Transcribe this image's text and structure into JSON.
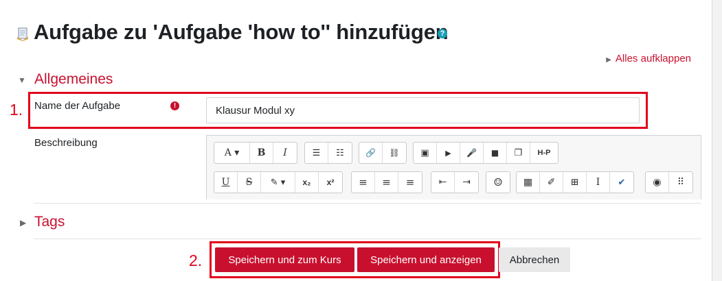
{
  "header": {
    "title": "Aufgabe zu 'Aufgabe 'how to'' hinzufügen",
    "help_icon": "question-circle-icon",
    "help_glyph": "?"
  },
  "expand_all": "Alles aufklappen",
  "sections": {
    "general": {
      "title": "Allgemeines"
    },
    "tags": {
      "title": "Tags"
    }
  },
  "fields": {
    "name": {
      "label": "Name der Aufgabe",
      "value": "Klausur Modul xy",
      "required_glyph": "!"
    },
    "description": {
      "label": "Beschreibung"
    }
  },
  "toolbar": {
    "row1": [
      {
        "name": "font-style-button",
        "glyph": "A ▾"
      },
      {
        "name": "bold-button",
        "glyph": "B"
      },
      {
        "name": "italic-button",
        "glyph": "I"
      },
      {
        "name": "unordered-list-button",
        "glyph": "☰"
      },
      {
        "name": "ordered-list-button",
        "glyph": "☷"
      },
      {
        "name": "link-button",
        "glyph": "🔗"
      },
      {
        "name": "unlink-button",
        "glyph": "⛓"
      },
      {
        "name": "image-button",
        "glyph": "▣"
      },
      {
        "name": "media-button",
        "glyph": "▶"
      },
      {
        "name": "record-audio-button",
        "glyph": "🎤"
      },
      {
        "name": "record-video-button",
        "glyph": "■"
      },
      {
        "name": "manage-files-button",
        "glyph": "❐"
      },
      {
        "name": "h5p-button",
        "glyph": "H-P"
      }
    ],
    "row2": [
      {
        "name": "underline-button",
        "glyph": "U"
      },
      {
        "name": "strikethrough-button",
        "glyph": "S"
      },
      {
        "name": "text-color-button",
        "glyph": "✎ ▾"
      },
      {
        "name": "subscript-button",
        "glyph": "x₂"
      },
      {
        "name": "superscript-button",
        "glyph": "x²"
      },
      {
        "name": "align-left-button",
        "glyph": "≡"
      },
      {
        "name": "align-center-button",
        "glyph": "≡"
      },
      {
        "name": "align-right-button",
        "glyph": "≡"
      },
      {
        "name": "outdent-button",
        "glyph": "⇤"
      },
      {
        "name": "indent-button",
        "glyph": "⇥"
      },
      {
        "name": "emoticon-button",
        "glyph": "☺"
      },
      {
        "name": "equation-button",
        "glyph": "▦"
      },
      {
        "name": "edit-button",
        "glyph": "✐"
      },
      {
        "name": "table-button",
        "glyph": "⊞"
      },
      {
        "name": "cursor-button",
        "glyph": "I"
      },
      {
        "name": "checkmark-button",
        "glyph": "✔"
      },
      {
        "name": "accessibility-button",
        "glyph": "◉"
      },
      {
        "name": "braille-button",
        "glyph": "⠿"
      }
    ]
  },
  "annotations": {
    "first": "1.",
    "second": "2."
  },
  "buttons": {
    "save_return": "Speichern und zum Kurs",
    "save_display": "Speichern und anzeigen",
    "cancel": "Abbrechen"
  },
  "colors": {
    "accent": "#c8102e",
    "annotation": "#e1001a",
    "help": "#1a9fb4"
  }
}
